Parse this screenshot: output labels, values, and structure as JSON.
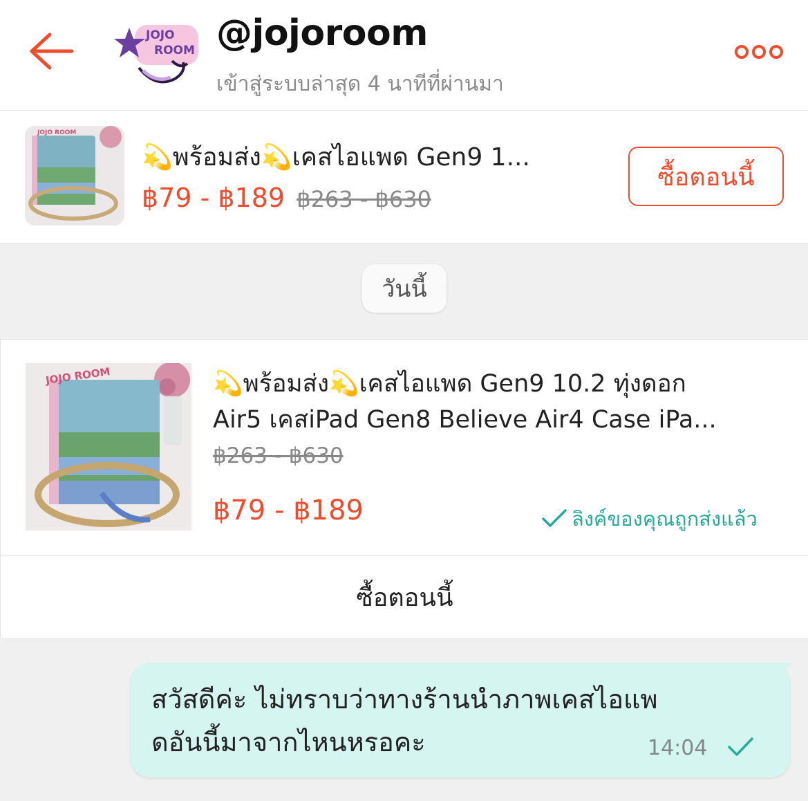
{
  "header": {
    "shop_name": "@jojoroom",
    "last_seen": "เข้าสู่ระบบล่าสุด 4 นาทีที่ผ่านมา",
    "avatar_logo_text": "JOJO ROOM",
    "back_icon": "back-arrow-icon",
    "more_icon": "more-dots-icon"
  },
  "pinned_product": {
    "title": "💫พร้อมส่ง💫เคสไอแพด Gen9 1...",
    "price": "฿79 - ฿189",
    "original_price": "฿263 - ฿630",
    "buy_label": "ซื้อตอนนี้"
  },
  "date_separator": "วันนี้",
  "product_card": {
    "title_line1": "💫พร้อมส่ง💫เคสไอแพด Gen9 10.2 ทุ่งดอก",
    "title_line2": "Air5 เคสiPad Gen8 Believe Air4 Case iPa...",
    "original_price": "฿263 - ฿630",
    "price": "฿79 - ฿189",
    "status": "ลิงค์ของคุณถูกส่งแล้ว",
    "buy_label": "ซื้อตอนนี้",
    "thumb_text": "JOJO ROOM"
  },
  "message": {
    "line1": "สวัสดีค่ะ ไม่ทราบว่าทางร้านนำภาพเคสไอแพ",
    "line2": "ดอันนี้มาจากไหนหรอคะ",
    "time": "14:04"
  },
  "colors": {
    "brand": "#ee4d2d",
    "sent": "#26aa99",
    "bubble": "#d5f5f0"
  }
}
